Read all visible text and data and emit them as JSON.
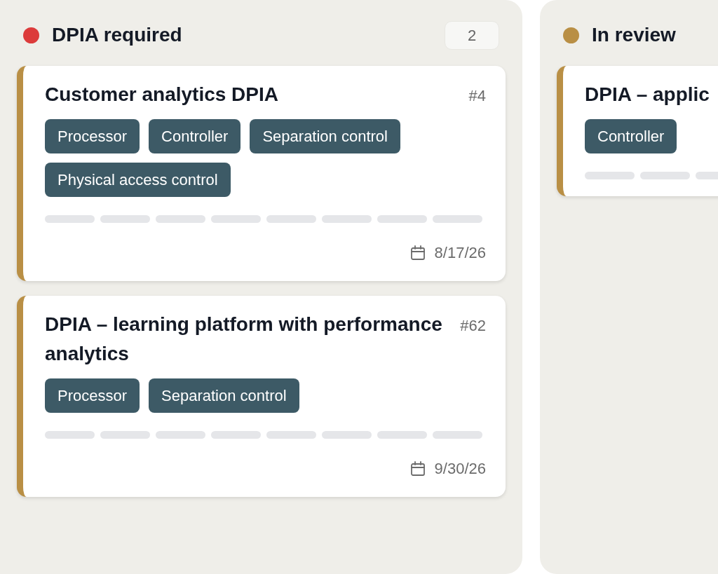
{
  "columns": [
    {
      "title": "DPIA required",
      "color": "#dc3b3b",
      "count": "2",
      "cards": [
        {
          "title": "Customer analytics DPIA",
          "number": "#4",
          "tags": [
            "Processor",
            "Controller",
            "Separation control",
            "Physical access control"
          ],
          "steps": [
            {
              "done": false
            },
            {
              "done": false
            },
            {
              "done": false
            },
            {
              "done": false
            },
            {
              "done": false
            },
            {
              "done": false
            },
            {
              "done": false
            },
            {
              "done": false
            }
          ],
          "date": "8/17/26"
        },
        {
          "title": "DPIA – learning platform with performance analytics",
          "number": "#62",
          "tags": [
            "Processor",
            "Separation control"
          ],
          "steps": [
            {
              "done": false
            },
            {
              "done": false
            },
            {
              "done": false
            },
            {
              "done": false
            },
            {
              "done": false
            },
            {
              "done": false
            },
            {
              "done": false
            },
            {
              "done": false
            }
          ],
          "date": "9/30/26"
        }
      ]
    },
    {
      "title": "In review",
      "color": "#b98f45",
      "cards": [
        {
          "title": "DPIA – applic",
          "tags": [
            "Controller"
          ],
          "steps": [
            {
              "done": false
            },
            {
              "done": false
            },
            {
              "done": false
            }
          ]
        }
      ]
    }
  ]
}
